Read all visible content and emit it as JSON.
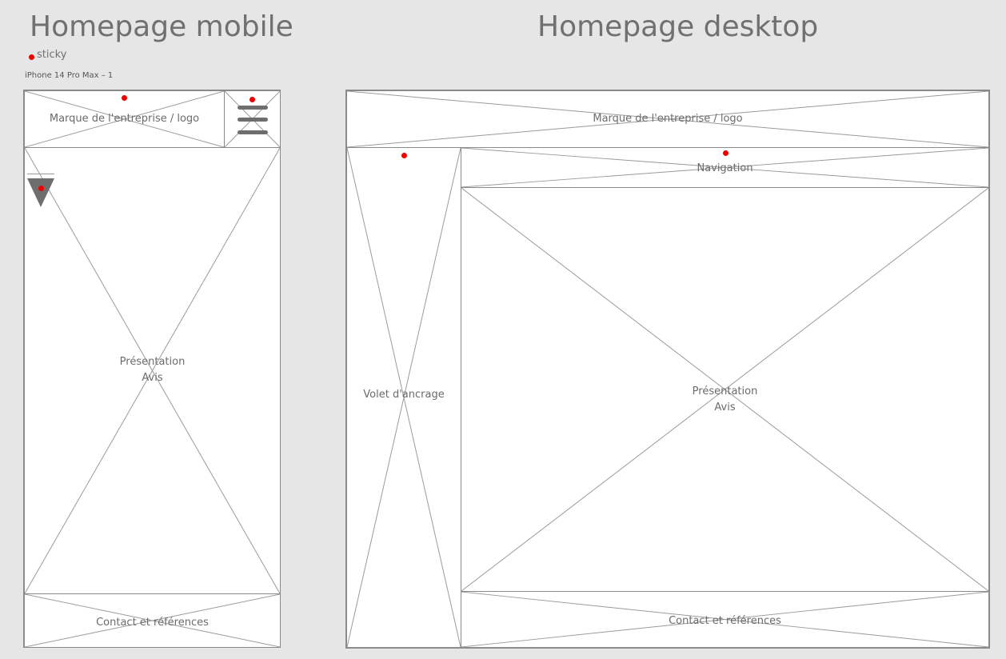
{
  "mobile": {
    "title": "Homepage mobile",
    "legend_label": "sticky",
    "frame_label": "iPhone 14 Pro Max – 1",
    "header_label": "Marque de l'entreprise / logo",
    "main_label_line1": "Présentation",
    "main_label_line2": "Avis",
    "footer_label": "Contact et références"
  },
  "desktop": {
    "title": "Homepage desktop",
    "header_label": "Marque de l'entreprise / logo",
    "sidebar_label": "Volet d'ancrage",
    "nav_label": "Navigation",
    "main_label_line1": "Présentation",
    "main_label_line2": "Avis",
    "footer_label": "Contact et références"
  },
  "colors": {
    "background": "#e6e6e6",
    "placeholder_fill": "#ffffff",
    "placeholder_stroke": "#8a8a8a",
    "sticky_marker": "#ee0000",
    "icon_gray": "#6e6e6e"
  }
}
